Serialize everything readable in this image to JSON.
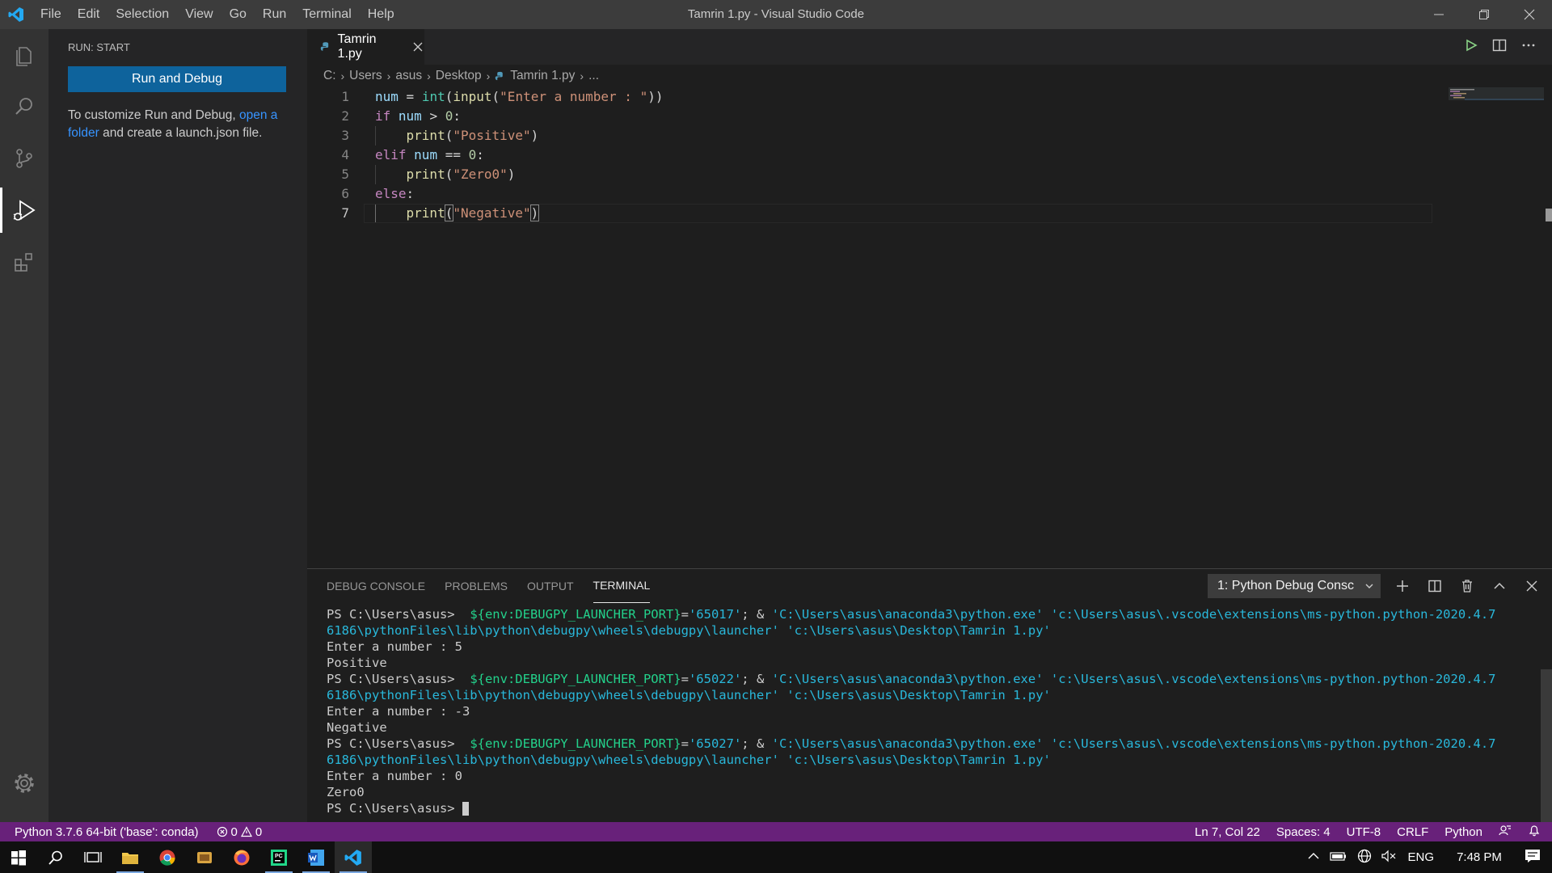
{
  "window": {
    "title": "Tamrin 1.py - Visual Studio Code",
    "menu": [
      "File",
      "Edit",
      "Selection",
      "View",
      "Go",
      "Run",
      "Terminal",
      "Help"
    ]
  },
  "sidebar": {
    "title": "RUN: START",
    "run_button": "Run and Debug",
    "text_before": "To customize Run and Debug, ",
    "link": "open a folder",
    "text_after": " and create a launch.json file."
  },
  "editor": {
    "tab_label": "Tamrin 1.py",
    "breadcrumb": [
      "C:",
      "Users",
      "asus",
      "Desktop",
      "Tamrin 1.py",
      "..."
    ],
    "current_line": 7
  },
  "panel": {
    "tabs": [
      "DEBUG CONSOLE",
      "PROBLEMS",
      "OUTPUT",
      "TERMINAL"
    ],
    "active_tab": "TERMINAL",
    "terminal_select": "1: Python Debug Consc",
    "prompt": "PS C:\\Users\\asus>",
    "runs": [
      {
        "port": "'65017'",
        "input": "Enter a number : 5",
        "output": "Positive"
      },
      {
        "port": "'65022'",
        "input": "Enter a number : -3",
        "output": "Negative"
      },
      {
        "port": "'65027'",
        "input": "Enter a number : 0",
        "output": "Zero0"
      }
    ],
    "cmd_env": "${env:DEBUGPY_LAUNCHER_PORT}",
    "cmd_eq": "=",
    "cmd_amp": "; & ",
    "cmd_python": "'C:\\Users\\asus\\anaconda3\\python.exe'",
    "cmd_launcher_1": "'c:\\Users\\asus\\.vscode\\extensions\\ms-python.python-2020.4.7",
    "cmd_launcher_2": "6186\\pythonFiles\\lib\\python\\debugpy\\wheels\\debugpy\\launcher'",
    "cmd_file": "'c:\\Users\\asus\\Desktop\\Tamrin 1.py'"
  },
  "status": {
    "interpreter": "Python 3.7.6 64-bit ('base': conda)",
    "errors": "0",
    "warnings": "0",
    "position": "Ln 7, Col 22",
    "spaces": "Spaces: 4",
    "encoding": "UTF-8",
    "eol": "CRLF",
    "language": "Python"
  },
  "taskbar": {
    "language": "ENG",
    "time": "7:48 PM"
  },
  "colors": {
    "statusbar": "#68217a",
    "accent_button": "#0e639c",
    "link": "#3794ff"
  }
}
